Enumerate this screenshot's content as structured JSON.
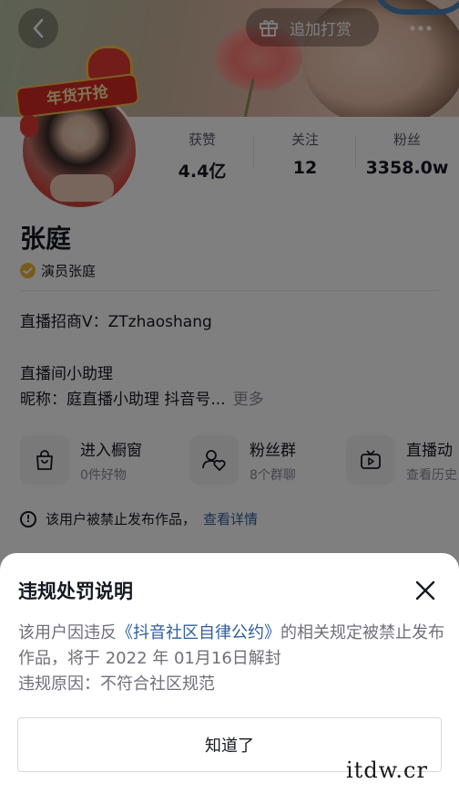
{
  "header": {
    "tip_label": "追加打赏",
    "icons": [
      "back-icon",
      "gift-icon",
      "more-icon"
    ]
  },
  "badge": {
    "text": "年货开抢"
  },
  "stats": {
    "likes": {
      "label": "获赞",
      "value": "4.4亿"
    },
    "following": {
      "label": "关注",
      "value": "12"
    },
    "fans": {
      "label": "粉丝",
      "value": "3358.0w"
    }
  },
  "profile": {
    "name": "张庭",
    "verification": "演员张庭",
    "bio_line1": "直播招商V：ZTzhaoshang",
    "bio_line2": "直播间小助理",
    "bio_line3": "昵称：庭直播小助理  抖音号...",
    "more": "更多"
  },
  "cards": [
    {
      "title": "进入橱窗",
      "subtitle": "0件好物",
      "icon": "shopping-bag-icon"
    },
    {
      "title": "粉丝群",
      "subtitle": "8个群聊",
      "icon": "fan-group-icon"
    },
    {
      "title": "直播动",
      "subtitle": "查看历史",
      "icon": "live-tv-icon"
    }
  ],
  "notice": {
    "text": "该用户被禁止发布作品，",
    "link": "查看详情"
  },
  "sheet": {
    "title": "违规处罚说明",
    "msg_pre": "该用户因违反",
    "msg_link": "《抖音社区自律公约》",
    "msg_post": "的相关规定被禁止发布作品，将于 2022 年 01月16日解封",
    "reason": "违规原因：不符合社区规范",
    "ok_label": "知道了"
  },
  "watermark": "itdw.cr",
  "colors": {
    "link": "#2f5e9d",
    "badge_gold": "#f2b93b",
    "overlay": "rgba(0,0,0,0.5)"
  }
}
